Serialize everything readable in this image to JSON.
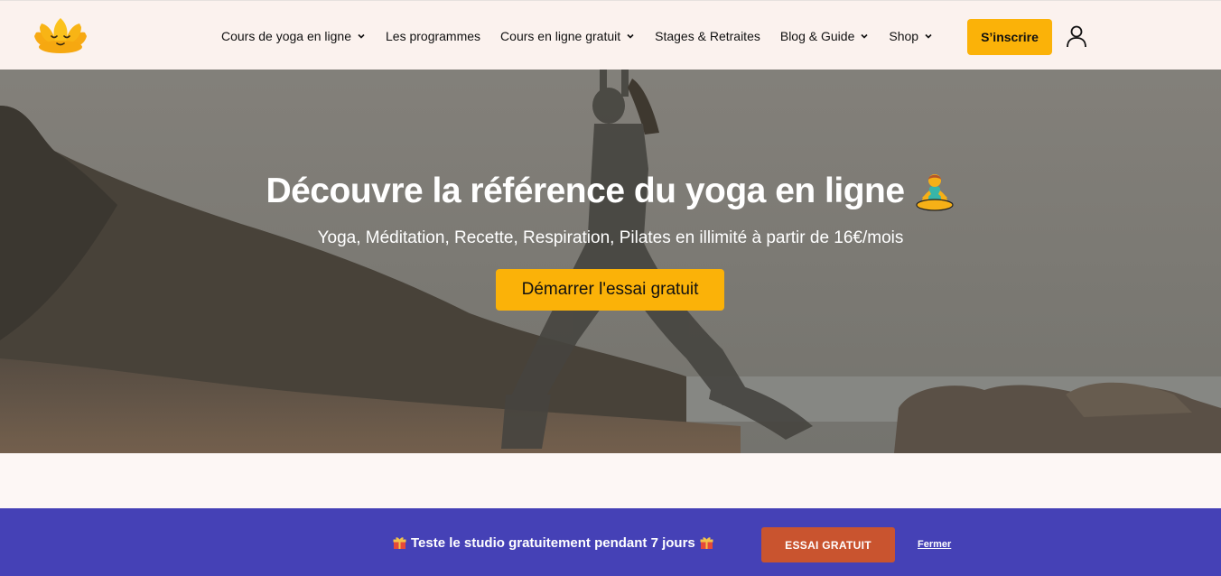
{
  "header": {
    "nav": [
      {
        "label": "Cours de yoga en ligne",
        "dropdown": true
      },
      {
        "label": "Les programmes",
        "dropdown": false
      },
      {
        "label": "Cours en ligne gratuit",
        "dropdown": true
      },
      {
        "label": "Stages & Retraites",
        "dropdown": false
      },
      {
        "label": "Blog & Guide",
        "dropdown": true
      },
      {
        "label": "Shop",
        "dropdown": true
      }
    ],
    "signup_label": "S’inscrire",
    "logo_icon": "lotus-logo-icon",
    "user_icon": "user-icon"
  },
  "hero": {
    "title": "Découvre la référence du yoga en ligne",
    "title_emoji": "person-in-lotus-position-emoji",
    "subtitle": "Yoga, Méditation, Recette, Respiration, Pilates en illimité à partir de 16€/mois",
    "cta_label": "Démarrer l'essai gratuit"
  },
  "banner": {
    "text": "Teste le studio gratuitement pendant 7 jours",
    "gift_icon": "gift-icon",
    "cta_label": "ESSAI GRATUIT",
    "close_label": "Fermer"
  },
  "colors": {
    "accent": "#fbb208",
    "header_bg": "#fbf2ee",
    "banner_bg": "#4541b6",
    "banner_button": "#c9542f"
  }
}
